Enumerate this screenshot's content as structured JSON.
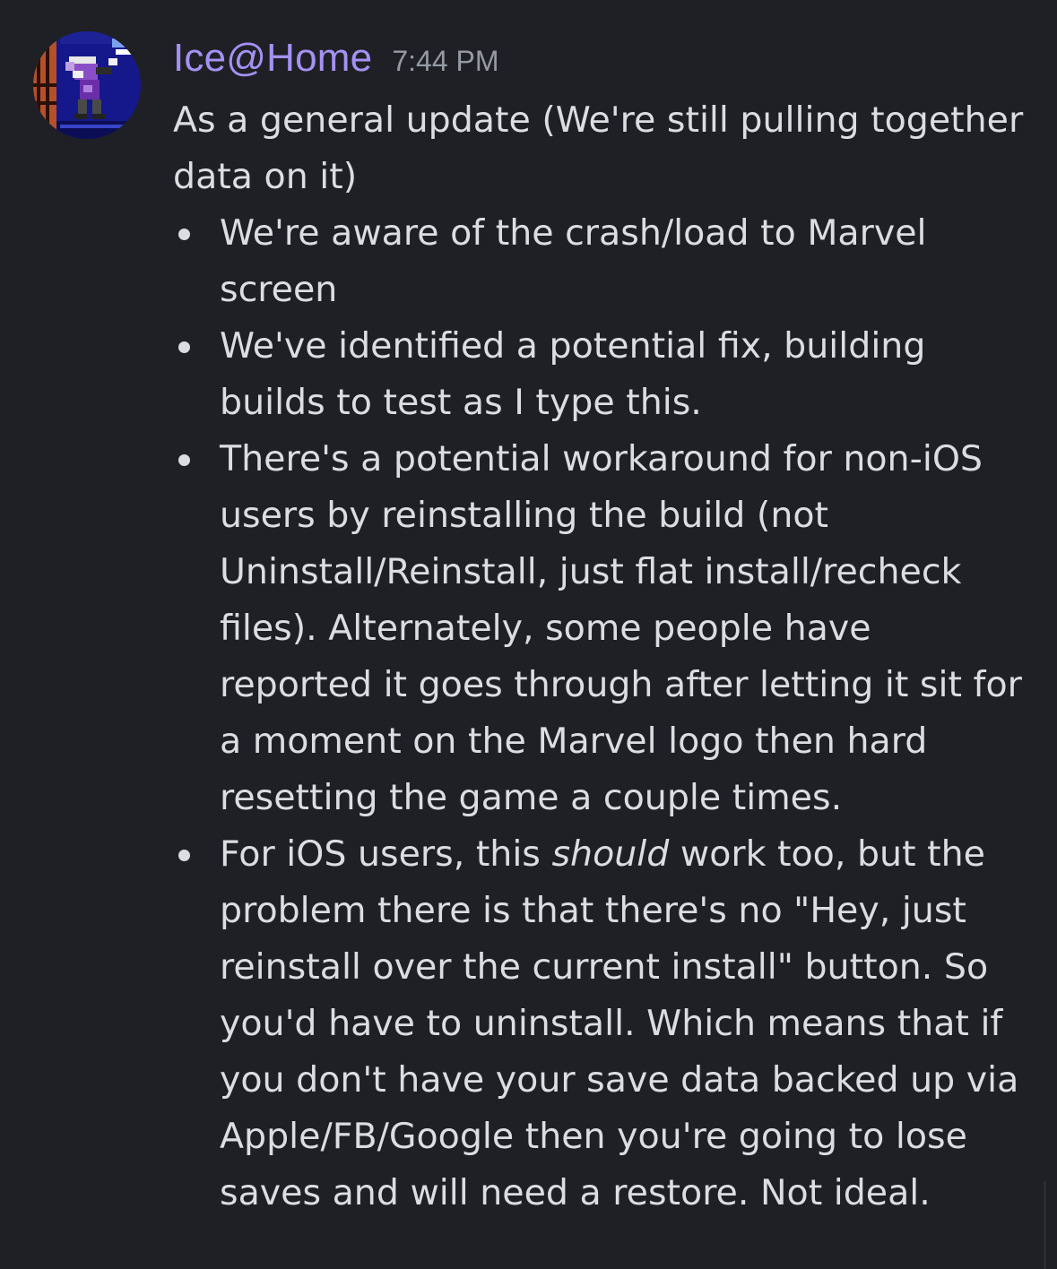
{
  "message": {
    "author": "Ice@Home",
    "timestamp": "7:44 PM",
    "avatar_icon": "pixel-art-character-avatar",
    "colors": {
      "background": "#1f2025",
      "username": "#a591f4",
      "timestamp": "#949ba4",
      "text": "#dbdee1"
    },
    "intro": "As a general update (We're still pulling together data on it)",
    "bullets": [
      {
        "text": "We're aware of the crash/load to Marvel screen"
      },
      {
        "text": "We've identified a potential fix, building builds to test as I type this."
      },
      {
        "text": "There's a potential workaround for non-iOS users by reinstalling the build (not Uninstall/Reinstall, just flat install/recheck files). Alternately, some people have reported it goes through after letting it sit for a moment on the Marvel logo then hard resetting the game a couple times."
      },
      {
        "pre": "For iOS users, this ",
        "emphasis": "should",
        "post": " work too, but the problem there is that there's no \"Hey, just reinstall over the current install\" button. So you'd have to uninstall. Which means that if you don't have your save data backed up via Apple/FB/Google then you're going to lose saves and will need a restore. Not ideal."
      }
    ]
  }
}
